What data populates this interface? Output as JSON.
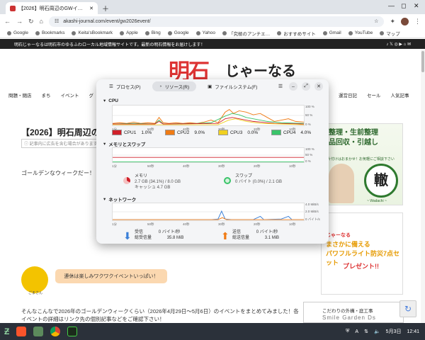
{
  "browser": {
    "tab_title": "【2026】明石周辺のGWイ…",
    "url": "akashi-journal.com/event/gw2026event/",
    "bookmarks": [
      "Google",
      "Bookmarks",
      "Keita'sBookmark",
      "Apple",
      "Bing",
      "Google",
      "Yahoo",
      "「究極のアンチエ…",
      "おすすめサイト",
      "Gmail",
      "YouTube",
      "マップ"
    ]
  },
  "page": {
    "topbar_text": "明石じゃーなるは明石市のゆるふわローカル地域情報サイトです。最新の明石情報をお届けします！",
    "logo_main": "明石",
    "logo_sub": "じゃーなる",
    "nav": [
      "問題・閉店",
      "まち",
      "イベント",
      "グ"
    ],
    "nav_right": [
      "運営日記",
      "セール",
      "人気記事"
    ],
    "post_title": "【2026】明石周辺のG",
    "ad_note": "ⓘ 記事内に広告を含む場合があります",
    "greeting": "ゴールデンなウィークだー！",
    "bubble_text": "連休は楽しみワクワクイベントいっぱい！",
    "avatar_name": "ごまさん",
    "body_text": "そんなこんなで2026年のゴールデンウィークくらい（2026年4月29日〜5月6日）のイベントをまとめてみました！各イベントの詳細はリンク先の個別記事などをご確認下さい！",
    "ad1": {
      "line1": "整理・生前整理",
      "line2": "品回収・引越し",
      "small": "片付けはおまかせ！お気軽にご相談下さい",
      "badge": "轍",
      "badge_sub": "~ Wadachi ~"
    },
    "ad2": {
      "line1": "じゃーなる",
      "line2": "まさかに備える",
      "line3": "パワフルライト防災7点セット",
      "line4": "プレゼント!!"
    },
    "ad3": {
      "line1": "こだわりの外構・庭工事",
      "line2": "Smile Garden Ds"
    }
  },
  "sysmon": {
    "tabs": [
      "プロセス(P)",
      "リソース(R)",
      "ファイルシステム(F)"
    ],
    "sections": {
      "cpu": "CPU",
      "memory": "メモリとスワップ",
      "network": "ネットワーク"
    },
    "time_labels": [
      "1分",
      "50秒",
      "40秒",
      "30秒",
      "20秒",
      "10秒"
    ],
    "cpu_yticks": [
      "100 %",
      "50 %",
      "0 %"
    ],
    "mem_yticks": [
      "100 %",
      "50 %",
      "0 %"
    ],
    "net_yticks": [
      "4.0 MiB/s",
      "2.0 MiB/s",
      "0 バイト/s"
    ],
    "cpus": [
      {
        "name": "CPU1",
        "value": "1.0%",
        "color": "#d0202a"
      },
      {
        "name": "CPU2",
        "value": "9.0%",
        "color": "#f07b14"
      },
      {
        "name": "CPU3",
        "value": "0.0%",
        "color": "#f0d020"
      },
      {
        "name": "CPU4",
        "value": "4.0%",
        "color": "#3ac46a"
      }
    ],
    "memory": {
      "label": "メモリ",
      "usage": "2.7 GB (34.1%) / 8.0 GB",
      "cache": "キャッシュ 4.7 GB"
    },
    "swap": {
      "label": "スワップ",
      "usage": "0 バイト (0.0%) / 2.1 GB"
    },
    "net_recv": {
      "label": "受信",
      "rate": "0 バイト/秒",
      "total_label": "総受信量",
      "total": "35.8 MiB"
    },
    "net_send": {
      "label": "送信",
      "rate": "0 バイト/秒",
      "total_label": "総送信量",
      "total": "3.1 MiB"
    }
  },
  "taskbar": {
    "lang": "A",
    "date": "5月3日",
    "time": "12:41"
  }
}
